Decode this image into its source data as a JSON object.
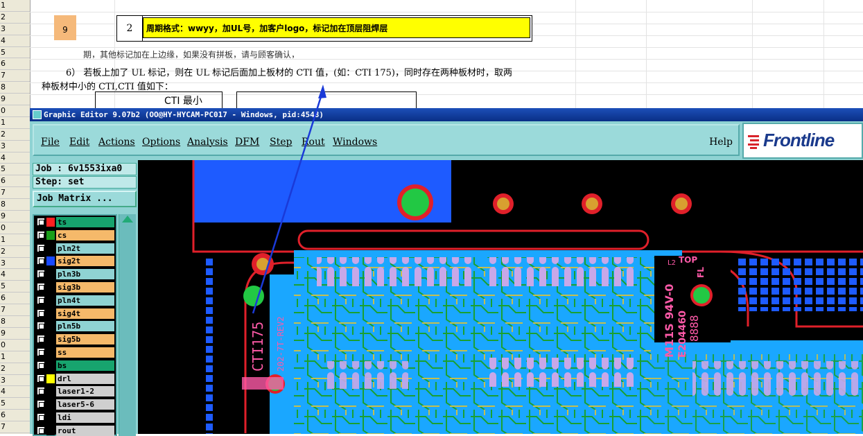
{
  "spreadsheet": {
    "row_numbers": [
      "1",
      "2",
      "3",
      "4",
      "5",
      "6",
      "7",
      "8",
      "9",
      "0",
      "1",
      "2",
      "3",
      "4",
      "5",
      "6",
      "7",
      "8",
      "9",
      "0",
      "1",
      "2",
      "3",
      "4",
      "5",
      "6",
      "7",
      "8",
      "9",
      "0",
      "1",
      "2",
      "3",
      "4",
      "5",
      "6",
      "7"
    ],
    "orange_cell_value": "9",
    "table_number": "2",
    "table_yellow_text": "周期格式：wwyy，加UL号，加客户logo，标记加在顶层阻焊层",
    "partial_line": "期，其他标记加在上边缘，如果没有拼板，请与顾客确认，",
    "para_line1": "6） 若板上加了 UL 标记，则在 UL 标记后面加上板材的 CTI 值，(如：CTI 175)，同时存在两种板材时，取两",
    "para_line2": "种板材中小的 CTI,CTI 值如下：",
    "cti_header": "CTI 最小"
  },
  "window": {
    "title": "Graphic Editor 9.07b2 (OO@HY-HYCAM-PC017 - Windows, pid:4548)"
  },
  "menubar": {
    "items": [
      "File",
      "Edit",
      "Actions",
      "Options",
      "Analysis",
      "DFM",
      "Step",
      "Rout",
      "Windows"
    ],
    "help": "Help",
    "logo_text": "Frontline"
  },
  "sidepanel": {
    "job": "Job : 6v1553ixa0",
    "step": "Step: set",
    "job_matrix_button": "Job Matrix ..."
  },
  "layers": [
    {
      "name": "ts",
      "swatch": "#ff2020",
      "bg": "#17a46e"
    },
    {
      "name": "cs",
      "swatch": "#1a9f1a",
      "bg": "#f5b96a"
    },
    {
      "name": "pln2t",
      "swatch": "#000000",
      "bg": "#8fd3d3"
    },
    {
      "name": "sig2t",
      "swatch": "#1848ff",
      "bg": "#f5b96a"
    },
    {
      "name": "pln3b",
      "swatch": "#000000",
      "bg": "#8fd3d3"
    },
    {
      "name": "sig3b",
      "swatch": "#000000",
      "bg": "#f5b96a"
    },
    {
      "name": "pln4t",
      "swatch": "#000000",
      "bg": "#8fd3d3"
    },
    {
      "name": "sig4t",
      "swatch": "#000000",
      "bg": "#f5b96a"
    },
    {
      "name": "pln5b",
      "swatch": "#000000",
      "bg": "#8fd3d3"
    },
    {
      "name": "sig5b",
      "swatch": "#000000",
      "bg": "#f5b96a"
    },
    {
      "name": "ss",
      "swatch": "#000000",
      "bg": "#f5b96a"
    },
    {
      "name": "bs",
      "swatch": "#000000",
      "bg": "#17a46e"
    },
    {
      "name": "drl",
      "swatch": "#ffff00",
      "bg": "#cfcfcf"
    },
    {
      "name": "laser1-2",
      "swatch": "#000000",
      "bg": "#cfcfcf"
    },
    {
      "name": "laser5-6",
      "swatch": "#000000",
      "bg": "#cfcfcf"
    },
    {
      "name": "ldi",
      "swatch": "#000000",
      "bg": "#cfcfcf"
    },
    {
      "name": "rout",
      "swatch": "#000000",
      "bg": "#cfcfcf"
    }
  ],
  "pcb": {
    "silk_cti": "CTI175",
    "silk_part": "202-7T-REV2",
    "silk_material": "M11S 94V-0",
    "silk_ul": "E204460",
    "silk_date": "8888",
    "silk_top": "TOP",
    "silk_fl": "FL",
    "silk_l2": "L2"
  }
}
